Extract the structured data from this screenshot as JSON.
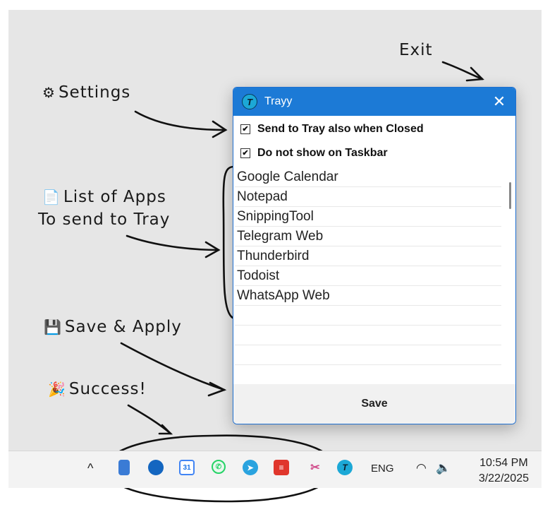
{
  "annotations": {
    "exit": "Exit",
    "settings": "Settings",
    "list_line1": "List of Apps",
    "list_line2": "To send to Tray",
    "save_apply": "Save & Apply",
    "success": "Success!"
  },
  "window": {
    "title": "Trayy",
    "app_icon_letter": "T",
    "close_glyph": "✕",
    "options": [
      {
        "label": "Send to Tray also when Closed",
        "checked": true
      },
      {
        "label": "Do not show on Taskbar",
        "checked": true
      }
    ],
    "apps": [
      "Google Calendar",
      "Notepad",
      "SnippingTool",
      "Telegram Web",
      "Thunderbird",
      "Todoist",
      "WhatsApp Web"
    ],
    "save_label": "Save"
  },
  "taskbar": {
    "overflow_glyph": "^",
    "calendar_day": "31",
    "language": "ENG",
    "time": "10:54 PM",
    "date": "3/22/2025"
  },
  "colors": {
    "accent": "#1c7ad6",
    "desktop": "#e6e6e6"
  }
}
